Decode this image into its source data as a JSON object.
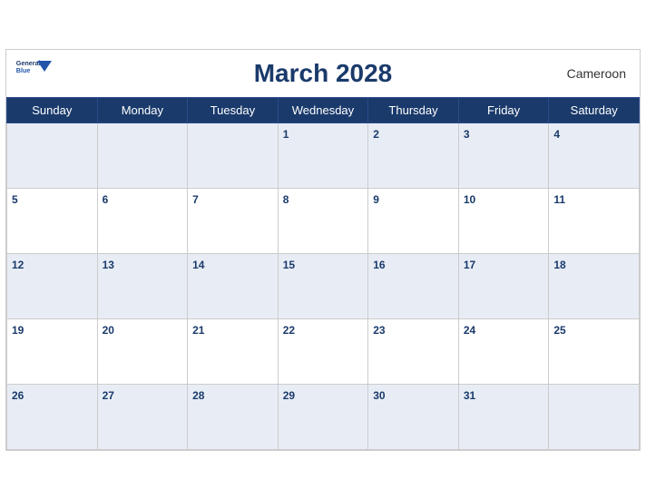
{
  "header": {
    "title": "March 2028",
    "country": "Cameroon",
    "logo_general": "General",
    "logo_blue": "Blue"
  },
  "weekdays": [
    "Sunday",
    "Monday",
    "Tuesday",
    "Wednesday",
    "Thursday",
    "Friday",
    "Saturday"
  ],
  "weeks": [
    [
      {
        "day": "",
        "empty": true
      },
      {
        "day": "",
        "empty": true
      },
      {
        "day": "",
        "empty": true
      },
      {
        "day": "1",
        "empty": false
      },
      {
        "day": "2",
        "empty": false
      },
      {
        "day": "3",
        "empty": false
      },
      {
        "day": "4",
        "empty": false
      }
    ],
    [
      {
        "day": "5",
        "empty": false
      },
      {
        "day": "6",
        "empty": false
      },
      {
        "day": "7",
        "empty": false
      },
      {
        "day": "8",
        "empty": false
      },
      {
        "day": "9",
        "empty": false
      },
      {
        "day": "10",
        "empty": false
      },
      {
        "day": "11",
        "empty": false
      }
    ],
    [
      {
        "day": "12",
        "empty": false
      },
      {
        "day": "13",
        "empty": false
      },
      {
        "day": "14",
        "empty": false
      },
      {
        "day": "15",
        "empty": false
      },
      {
        "day": "16",
        "empty": false
      },
      {
        "day": "17",
        "empty": false
      },
      {
        "day": "18",
        "empty": false
      }
    ],
    [
      {
        "day": "19",
        "empty": false
      },
      {
        "day": "20",
        "empty": false
      },
      {
        "day": "21",
        "empty": false
      },
      {
        "day": "22",
        "empty": false
      },
      {
        "day": "23",
        "empty": false
      },
      {
        "day": "24",
        "empty": false
      },
      {
        "day": "25",
        "empty": false
      }
    ],
    [
      {
        "day": "26",
        "empty": false
      },
      {
        "day": "27",
        "empty": false
      },
      {
        "day": "28",
        "empty": false
      },
      {
        "day": "29",
        "empty": false
      },
      {
        "day": "30",
        "empty": false
      },
      {
        "day": "31",
        "empty": false
      },
      {
        "day": "",
        "empty": true
      }
    ]
  ]
}
